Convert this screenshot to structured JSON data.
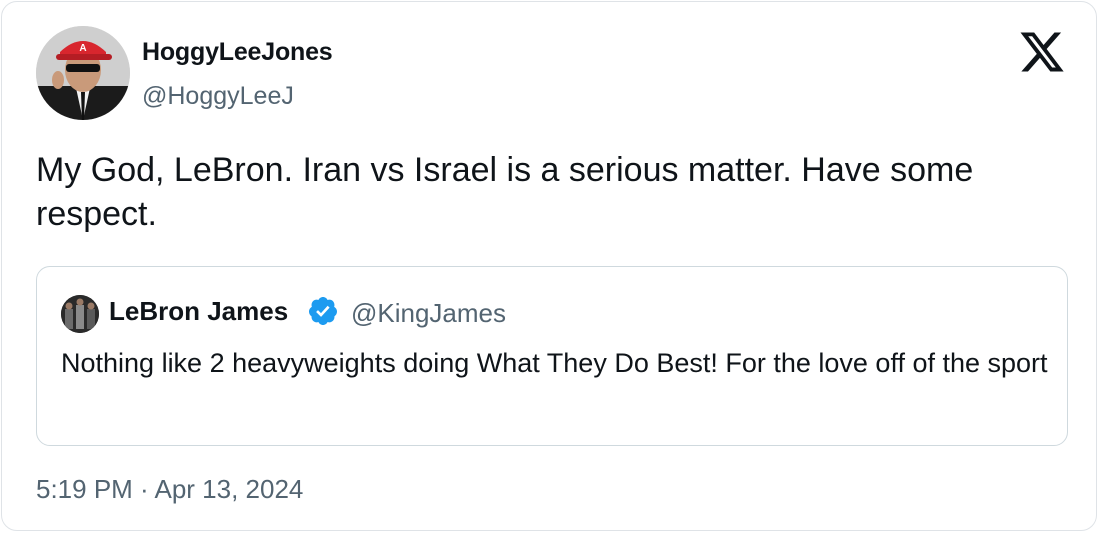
{
  "author": {
    "display_name": "HoggyLeeJones",
    "handle": "@HoggyLeeJ",
    "avatar_icon": "user-avatar-photo"
  },
  "platform": {
    "logo_icon": "x-logo-icon"
  },
  "tweet": {
    "text": "My God, LeBron. Iran vs Israel is a serious matter. Have some respect.",
    "timestamp": "5:19 PM · Apr 13, 2024"
  },
  "quoted_tweet": {
    "display_name": "LeBron James",
    "handle": "@KingJames",
    "verified": true,
    "verified_color": "#1d9bf0",
    "text": "Nothing like 2 heavyweights doing What They Do Best! For the love off of the sport"
  },
  "colors": {
    "text_primary": "#0f1419",
    "text_secondary": "#536471",
    "border": "#cfd9de"
  }
}
